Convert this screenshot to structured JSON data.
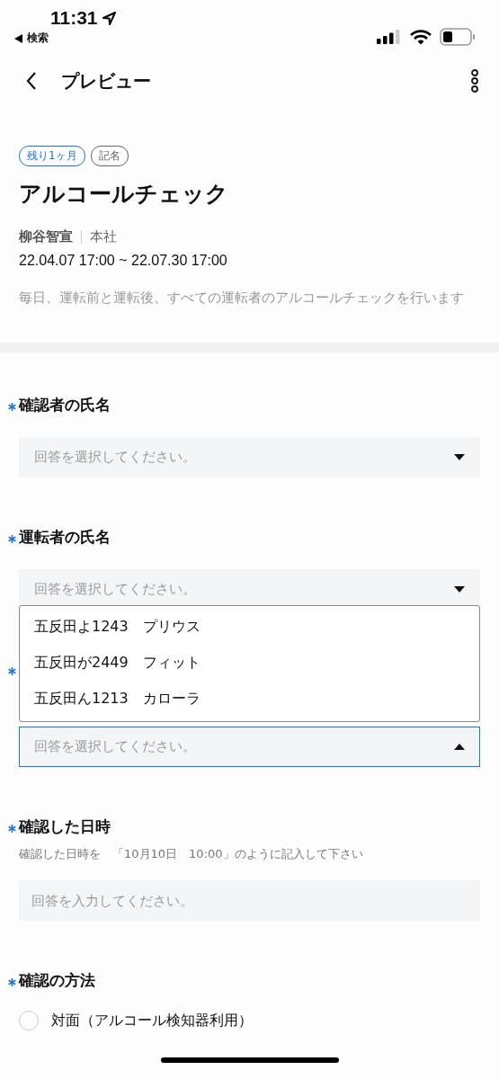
{
  "status_bar": {
    "time": "11:31",
    "back_label": "検索"
  },
  "header": {
    "title": "プレビュー"
  },
  "survey": {
    "tags": [
      {
        "label": "残り1ヶ月",
        "color": "#1a73e8"
      },
      {
        "label": "記名",
        "color": "#666666"
      }
    ],
    "title": "アルコールチェック",
    "author": "柳谷智宣",
    "department": "本社",
    "period": "22.04.07 17:00 ~ 22.07.30 17:00",
    "description": "毎日、運転前と運転後、すべての運転者のアルコールチェックを行います"
  },
  "questions": [
    {
      "kind": "select",
      "required": true,
      "label": "確認者の氏名",
      "placeholder": "回答を選択してください。",
      "expanded": false
    },
    {
      "kind": "select",
      "required": true,
      "label": "運転者の氏名",
      "placeholder": "回答を選択してください。",
      "expanded": false
    },
    {
      "kind": "select",
      "required": true,
      "placeholder": "回答を選択してください。",
      "expanded": true,
      "options": [
        "五反田よ1243　プリウス",
        "五反田が2449　フィット",
        "五反田ん1213　カローラ"
      ]
    },
    {
      "kind": "text",
      "required": true,
      "label": "確認した日時",
      "hint": "確認した日時を　「10月10日　10:00」のように記入して下さい",
      "placeholder": "回答を入力してください。"
    },
    {
      "kind": "radio",
      "required": true,
      "label": "確認の方法",
      "options": [
        {
          "label": "対面（アルコール検知器利用）",
          "selected": false
        }
      ]
    }
  ]
}
